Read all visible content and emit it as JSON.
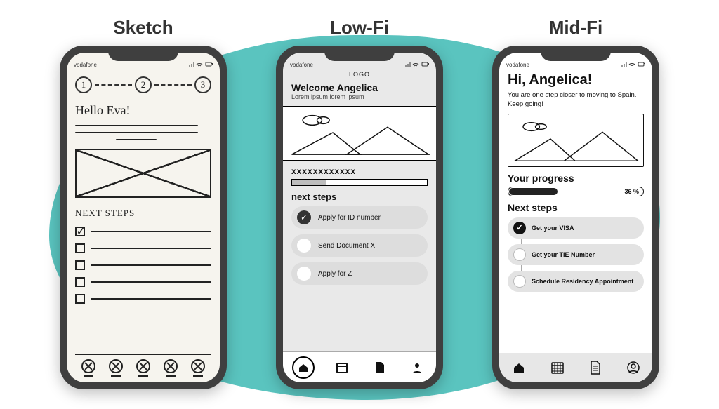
{
  "titles": {
    "sketch": "Sketch",
    "lofi": "Low-Fi",
    "midfi": "Mid-Fi"
  },
  "statusbar": {
    "carrier": "vodafone"
  },
  "sketch": {
    "steps": [
      "1",
      "2",
      "3"
    ],
    "greeting": "Hello Eva!",
    "next_heading": "NEXT STEPS",
    "checklist": [
      {
        "checked": true
      },
      {
        "checked": false
      },
      {
        "checked": false
      },
      {
        "checked": false
      },
      {
        "checked": false
      }
    ]
  },
  "lofi": {
    "logo": "LOGO",
    "welcome": "Welcome Angelica",
    "sub": "Lorem ipsum lorem ipsum",
    "progress_label": "xxxxxxxxxxxx",
    "next_heading": "next steps",
    "steps": [
      {
        "label": "Apply for ID number",
        "done": true
      },
      {
        "label": "Send Document X",
        "done": false
      },
      {
        "label": "Apply for Z",
        "done": false
      }
    ]
  },
  "midfi": {
    "greeting": "Hi, Angelica!",
    "sub": "You are one step closer to moving to Spain. Keep going!",
    "progress_heading": "Your progress",
    "progress_pct": "36 %",
    "next_heading": "Next steps",
    "steps": [
      {
        "label": "Get your VISA",
        "done": true
      },
      {
        "label": "Get your TIE Number",
        "done": false
      },
      {
        "label": "Schedule Residency Appointment",
        "done": false
      }
    ]
  }
}
